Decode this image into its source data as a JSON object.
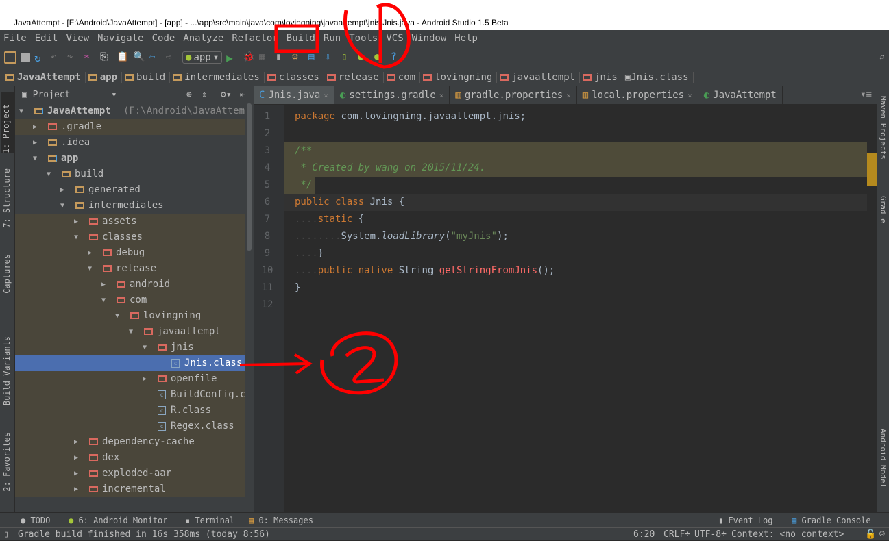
{
  "window": {
    "title": "JavaAttempt - [F:\\Android\\JavaAttempt] - [app] - ...\\app\\src\\main\\java\\com\\lovingning\\javaattempt\\jnis\\Jnis.java - Android Studio 1.5 Beta"
  },
  "menu": [
    "File",
    "Edit",
    "View",
    "Navigate",
    "Code",
    "Analyze",
    "Refactor",
    "Build",
    "Run",
    "Tools",
    "VCS",
    "Window",
    "Help"
  ],
  "toolbar": {
    "run_config": "app"
  },
  "breadcrumbs": [
    "JavaAttempt",
    "app",
    "build",
    "intermediates",
    "classes",
    "release",
    "com",
    "lovingning",
    "javaattempt",
    "jnis",
    "Jnis.class"
  ],
  "left_tool_tabs": [
    "1: Project",
    "7: Structure",
    "Captures",
    "Build Variants",
    "2: Favorites"
  ],
  "right_tool_tabs": [
    "Maven Projects",
    "Gradle",
    "Android Model"
  ],
  "project_panel": {
    "view": "Project",
    "root_path": "(F:\\Android\\JavaAttempt)",
    "tree": [
      {
        "label": "JavaAttempt",
        "level": 0,
        "arrow": "down",
        "type": "root",
        "bold": true
      },
      {
        "label": ".gradle",
        "level": 1,
        "arrow": "right",
        "type": "excluded",
        "olive": true
      },
      {
        "label": ".idea",
        "level": 1,
        "arrow": "right",
        "type": "folder"
      },
      {
        "label": "app",
        "level": 1,
        "arrow": "down",
        "type": "module",
        "bold": true
      },
      {
        "label": "build",
        "level": 2,
        "arrow": "down",
        "type": "folder"
      },
      {
        "label": "generated",
        "level": 3,
        "arrow": "right",
        "type": "folder"
      },
      {
        "label": "intermediates",
        "level": 3,
        "arrow": "down",
        "type": "folder"
      },
      {
        "label": "assets",
        "level": 4,
        "arrow": "right",
        "type": "excluded",
        "olive": true
      },
      {
        "label": "classes",
        "level": 4,
        "arrow": "down",
        "type": "excluded",
        "olive": true
      },
      {
        "label": "debug",
        "level": 5,
        "arrow": "right",
        "type": "excluded",
        "olive": true
      },
      {
        "label": "release",
        "level": 5,
        "arrow": "down",
        "type": "excluded",
        "olive": true
      },
      {
        "label": "android",
        "level": 6,
        "arrow": "right",
        "type": "excluded",
        "olive": true
      },
      {
        "label": "com",
        "level": 6,
        "arrow": "down",
        "type": "excluded",
        "olive": true
      },
      {
        "label": "lovingning",
        "level": 7,
        "arrow": "down",
        "type": "excluded",
        "olive": true
      },
      {
        "label": "javaattempt",
        "level": 8,
        "arrow": "down",
        "type": "excluded",
        "olive": true
      },
      {
        "label": "jnis",
        "level": 9,
        "arrow": "down",
        "type": "excluded",
        "olive": true
      },
      {
        "label": "Jnis.class",
        "level": 10,
        "arrow": "",
        "type": "class",
        "selected": true
      },
      {
        "label": "openfile",
        "level": 9,
        "arrow": "right",
        "type": "excluded",
        "olive": true
      },
      {
        "label": "BuildConfig.cla",
        "level": 9,
        "arrow": "",
        "type": "class",
        "olive": true
      },
      {
        "label": "R.class",
        "level": 9,
        "arrow": "",
        "type": "class",
        "olive": true
      },
      {
        "label": "Regex.class",
        "level": 9,
        "arrow": "",
        "type": "class",
        "olive": true
      },
      {
        "label": "dependency-cache",
        "level": 4,
        "arrow": "right",
        "type": "excluded",
        "olive": true
      },
      {
        "label": "dex",
        "level": 4,
        "arrow": "right",
        "type": "excluded",
        "olive": true
      },
      {
        "label": "exploded-aar",
        "level": 4,
        "arrow": "right",
        "type": "excluded",
        "olive": true
      },
      {
        "label": "incremental",
        "level": 4,
        "arrow": "right",
        "type": "excluded",
        "olive": true
      }
    ]
  },
  "editor": {
    "tabs": [
      {
        "label": "Jnis.java",
        "icon": "class-icon",
        "active": true
      },
      {
        "label": "settings.gradle",
        "icon": "gradle-icon"
      },
      {
        "label": "gradle.properties",
        "icon": "properties-icon"
      },
      {
        "label": "local.properties",
        "icon": "properties-icon"
      },
      {
        "label": "JavaAttempt",
        "icon": "gradle-icon"
      }
    ],
    "lines": [
      [
        [
          "kw",
          "package "
        ],
        [
          "plain",
          "com.lovingning.javaattempt.jnis;"
        ]
      ],
      [],
      [
        [
          "cm",
          "/**"
        ]
      ],
      [
        [
          "cm",
          " * Created by wang on 2015/11/24."
        ]
      ],
      [
        [
          "cm",
          " */"
        ]
      ],
      [
        [
          "kw",
          "public class "
        ],
        [
          "plain",
          "Jnis {"
        ]
      ],
      [
        [
          "dots",
          "...."
        ],
        [
          "kw",
          "static "
        ],
        [
          "plain",
          "{"
        ]
      ],
      [
        [
          "dots",
          "........"
        ],
        [
          "plain",
          "System."
        ],
        [
          "plain it",
          "loadLibrary"
        ],
        [
          "plain",
          "("
        ],
        [
          "str",
          "\"myJnis\""
        ],
        [
          "plain",
          ");"
        ]
      ],
      [
        [
          "dots",
          "...."
        ],
        [
          "plain",
          "}"
        ]
      ],
      [
        [
          "dots",
          "...."
        ],
        [
          "kw",
          "public native "
        ],
        [
          "plain",
          "String "
        ],
        [
          "err",
          "getStringFromJnis"
        ],
        [
          "plain",
          "();"
        ]
      ],
      [
        [
          "plain",
          "}"
        ]
      ],
      []
    ]
  },
  "bottom_tools": {
    "left": [
      "TODO",
      "6: Android Monitor",
      "Terminal",
      "0: Messages"
    ],
    "right": [
      "Event Log",
      "Gradle Console"
    ]
  },
  "status": {
    "message": "Gradle build finished in 16s 358ms (today 8:56)",
    "position": "6:20",
    "line_sep": "CRLF÷",
    "encoding": "UTF-8÷",
    "context": "Context: <no context>"
  },
  "annotations": {
    "one": "1",
    "two": "2",
    "color": "#ff0000"
  }
}
